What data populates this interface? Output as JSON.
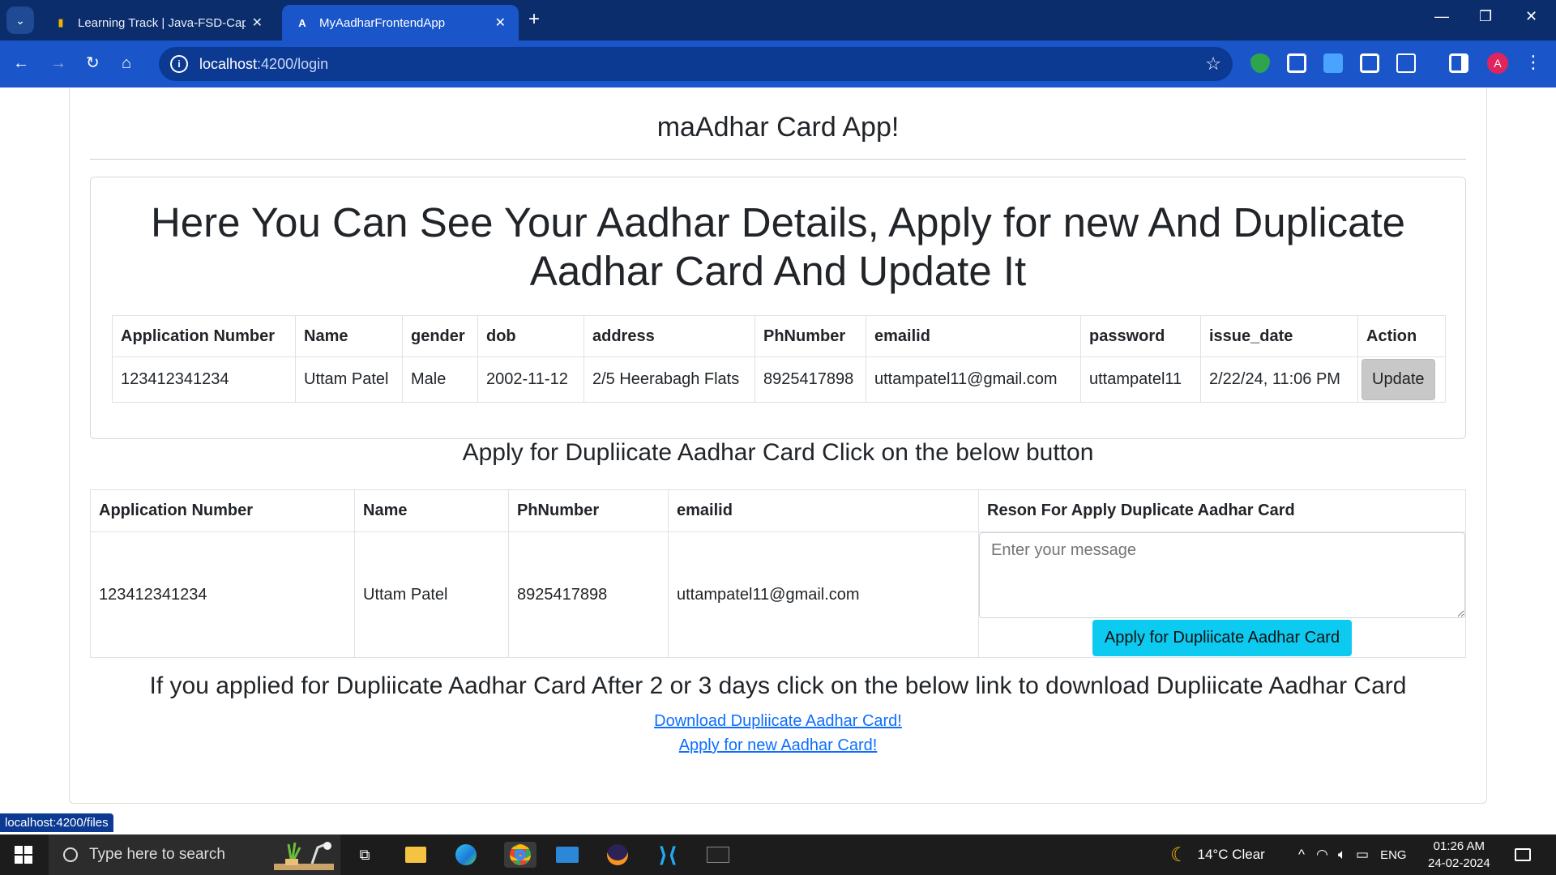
{
  "browser": {
    "tabs": [
      {
        "title": "Learning Track | Java-FSD-Capst",
        "active": false
      },
      {
        "title": "MyAadharFrontendApp",
        "active": true
      }
    ],
    "url_host": "localhost",
    "url_path": ":4200/login",
    "status_url": "localhost:4200/files"
  },
  "page": {
    "app_title": "maAdhar Card App!",
    "details_heading": "Here You Can See Your Aadhar Details, Apply for new And Duplicate Aadhar Card And Update It",
    "details_table": {
      "headers": [
        "Application Number",
        "Name",
        "gender",
        "dob",
        "address",
        "PhNumber",
        "emailid",
        "password",
        "issue_date",
        "Action"
      ],
      "row": [
        "123412341234",
        "Uttam Patel",
        "Male",
        "2002-11-12",
        "2/5 Heerabagh Flats",
        "8925417898",
        "uttampatel11@gmail.com",
        "uttampatel11",
        "2/22/24, 11:06 PM"
      ],
      "update_label": "Update"
    },
    "duplicate_heading": "Apply for Dupliicate Aadhar Card Click on the below button",
    "duplicate_table": {
      "headers": [
        "Application Number",
        "Name",
        "PhNumber",
        "emailid",
        "Reson For Apply Duplicate Aadhar Card"
      ],
      "row": [
        "123412341234",
        "Uttam Patel",
        "8925417898",
        "uttampatel11@gmail.com"
      ],
      "reason_placeholder": "Enter your message",
      "apply_label": "Apply for Dupliicate Aadhar Card"
    },
    "info_line": "If you applied for Dupliicate Aadhar Card After 2 or 3 days click on the below link to download Dupliicate Aadhar Card",
    "download_link": "Download Dupliicate Aadhar Card!",
    "apply_new_link": "Apply for new Aadhar Card!"
  },
  "taskbar": {
    "search_placeholder": "Type here to search",
    "weather": "14°C  Clear",
    "language": "ENG",
    "time": "01:26 AM",
    "date": "24-02-2024"
  },
  "colors": {
    "tabbar": "#0b2d6b",
    "toolbar": "#1a56c9",
    "info_button": "#0dcaf0",
    "link": "#0d6efd"
  }
}
